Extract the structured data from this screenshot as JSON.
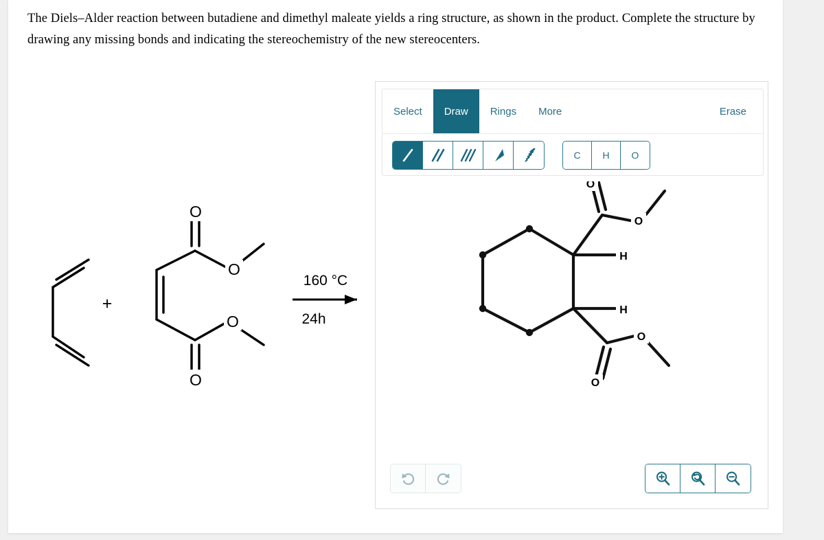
{
  "prompt": {
    "text": "The Diels–Alder reaction between butadiene and dimethyl maleate yields a ring structure, as shown in the product. Complete the structure by drawing any missing bonds and indicating the stereochemistry of the new stereocenters."
  },
  "reaction": {
    "plus_sign": "+",
    "conditions_above": "160 °C",
    "conditions_below": "24h",
    "reactant_1_name": "butadiene",
    "reactant_2_name": "dimethyl maleate",
    "reactant_2_labels": {
      "carbonyl_o_top": "O",
      "ester_o_top": "O",
      "ester_o_bottom": "O",
      "carbonyl_o_bottom": "O"
    }
  },
  "editor": {
    "tabs": [
      {
        "label": "Select",
        "active": false
      },
      {
        "label": "Draw",
        "active": true
      },
      {
        "label": "Rings",
        "active": false
      },
      {
        "label": "More",
        "active": false
      }
    ],
    "erase_label": "Erase",
    "bond_tools": [
      {
        "name": "single-bond",
        "active": true
      },
      {
        "name": "double-bond",
        "active": false
      },
      {
        "name": "triple-bond",
        "active": false
      },
      {
        "name": "wedge-bond",
        "active": false
      },
      {
        "name": "hash-bond",
        "active": false
      }
    ],
    "atom_buttons": [
      {
        "label": "C"
      },
      {
        "label": "H"
      },
      {
        "label": "O"
      }
    ],
    "history_buttons": [
      {
        "name": "undo-button"
      },
      {
        "name": "redo-button"
      }
    ],
    "zoom_buttons": [
      {
        "name": "zoom-in-button"
      },
      {
        "name": "zoom-reset-button"
      },
      {
        "name": "zoom-out-button"
      }
    ],
    "colors": {
      "accent": "#17697f",
      "outline": "#2a7b90",
      "text": "#2a6f84",
      "muted": "#9cb7c0"
    }
  },
  "product": {
    "name": "dimethyl cyclohexane-1,2-dicarboxylate",
    "labels": {
      "h_upper": "H",
      "h_lower": "H",
      "o_carbonyl_upper": "O",
      "o_ester_upper": "O",
      "o_ester_lower": "O",
      "o_carbonyl_lower": "O"
    }
  }
}
